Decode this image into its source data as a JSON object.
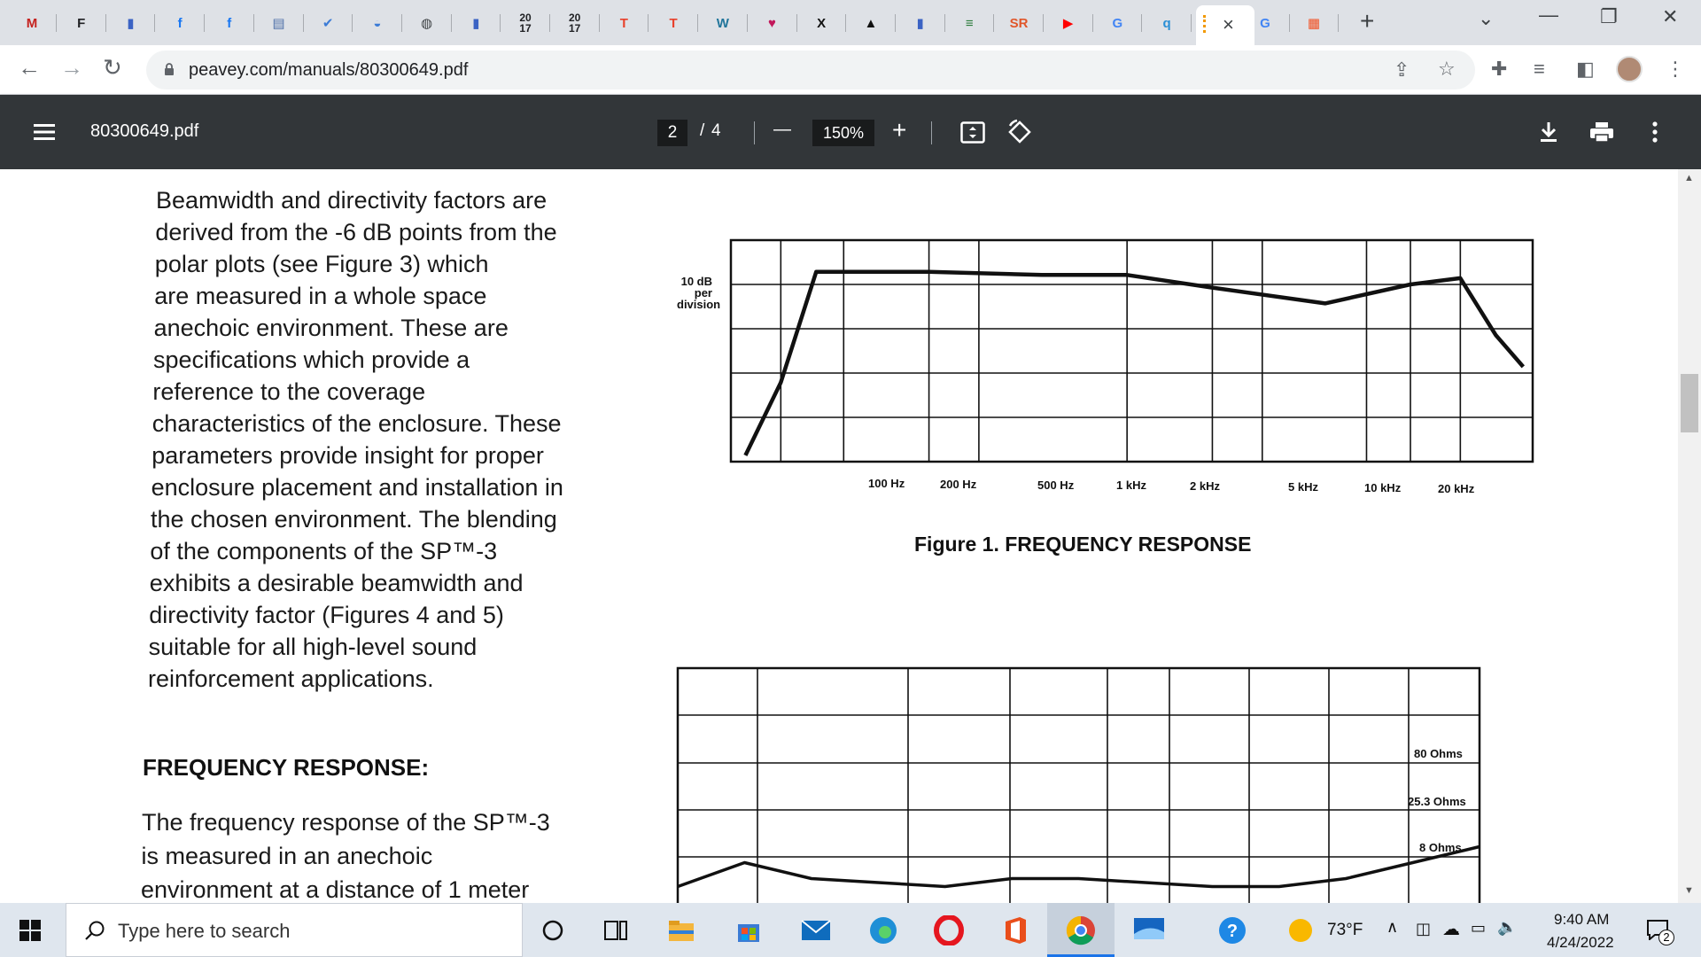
{
  "browser": {
    "tabs": [
      {
        "name": "gmail",
        "glyph": "M",
        "color": "#c5221f"
      },
      {
        "name": "tab-2",
        "glyph": "F",
        "color": "#202124"
      },
      {
        "name": "tab-3",
        "glyph": "▮",
        "color": "#3b63c4"
      },
      {
        "name": "facebook-1",
        "glyph": "f",
        "color": "#1877f2"
      },
      {
        "name": "facebook-2",
        "glyph": "f",
        "color": "#1877f2"
      },
      {
        "name": "tab-6",
        "glyph": "▤",
        "color": "#4d6fa8"
      },
      {
        "name": "tab-7",
        "glyph": "✔",
        "color": "#3b7bd6"
      },
      {
        "name": "tab-8",
        "glyph": "◒",
        "color": "#3b7bd6"
      },
      {
        "name": "tab-9",
        "glyph": "◍",
        "color": "#3c4043"
      },
      {
        "name": "tab-10",
        "glyph": "▮",
        "color": "#3b63c4"
      },
      {
        "name": "tab-2017-a",
        "glyph": "20\n17",
        "color": "#202124"
      },
      {
        "name": "tab-2017-b",
        "glyph": "20\n17",
        "color": "#202124"
      },
      {
        "name": "tab-t-1",
        "glyph": "T",
        "color": "#e8412c"
      },
      {
        "name": "tab-t-2",
        "glyph": "T",
        "color": "#e8412c"
      },
      {
        "name": "wordpress",
        "glyph": "W",
        "color": "#21759b"
      },
      {
        "name": "tab-heart",
        "glyph": "♥",
        "color": "#c2185b"
      },
      {
        "name": "tab-x",
        "glyph": "X",
        "color": "#111111"
      },
      {
        "name": "tab-triangle",
        "glyph": "▲",
        "color": "#111111"
      },
      {
        "name": "tab-12",
        "glyph": "▮",
        "color": "#3b63c4"
      },
      {
        "name": "tab-13",
        "glyph": "≡",
        "color": "#2a7a3a"
      },
      {
        "name": "tab-sr",
        "glyph": "SR",
        "color": "#e0562a"
      },
      {
        "name": "youtube",
        "glyph": "▶",
        "color": "#ff0000"
      },
      {
        "name": "google-1",
        "glyph": "G",
        "color": "#4285f4"
      },
      {
        "name": "tab-q",
        "glyph": "q",
        "color": "#2a8fd6"
      }
    ],
    "after_tabs": [
      {
        "name": "google-2",
        "glyph": "G",
        "color": "#4285f4"
      },
      {
        "name": "microsoft",
        "glyph": "▦",
        "color": "#f25022"
      }
    ],
    "active_tab_close": "×",
    "new_tab": "+",
    "window_controls": {
      "dropdown": "⌄",
      "minimize": "—",
      "restore": "❐",
      "close": "✕"
    },
    "url": "peavey.com/manuals/80300649.pdf"
  },
  "pdf": {
    "title": "80300649.pdf",
    "current_page": "2",
    "page_sep": "/",
    "total_pages": "4",
    "zoom": "150%",
    "zoom_out": "—",
    "zoom_in": "+"
  },
  "document": {
    "paragraph1": [
      "Beamwidth and directivity factors are",
      "derived from the -6 dB points from the",
      "polar plots (see Figure 3) which",
      "are measured in a whole space",
      "anechoic environment. These are",
      "specifications which provide a",
      "reference to the coverage",
      "characteristics of the enclosure. These",
      "parameters provide insight for proper",
      "enclosure placement and installation in",
      "the chosen environment. The blending",
      "of the components of the SP™-3",
      "exhibits a desirable beamwidth and",
      "directivity factor (Figures 4 and 5)",
      "suitable for all high-level sound",
      "reinforcement applications."
    ],
    "heading": "FREQUENCY RESPONSE:",
    "paragraph2": [
      "The frequency response of the SP™-3",
      "is measured in an anechoic",
      "environment at a distance of 1 meter"
    ],
    "figure1": {
      "caption": "Figure 1. FREQUENCY RESPONSE",
      "scale_label": [
        "10 dB",
        "per",
        "division"
      ],
      "x_ticks": [
        "100 Hz",
        "200 Hz",
        "500 Hz",
        "1 kHz",
        "2 kHz",
        "5 kHz",
        "10 kHz",
        "20  kHz"
      ]
    },
    "figure2": {
      "labels": [
        "80 Ohms",
        "25.3 Ohms",
        "8 Ohms"
      ]
    }
  },
  "chart_data": [
    {
      "type": "line",
      "title": "Figure 1. FREQUENCY RESPONSE",
      "ylabel": "10 dB per division",
      "x_scale": "log",
      "x": [
        45,
        60,
        80,
        100,
        200,
        500,
        1000,
        2000,
        5000,
        10000,
        15000,
        20000,
        25000
      ],
      "series": [
        {
          "values": [
            -5.8,
            -3.5,
            0,
            0,
            0,
            -0.1,
            -0.1,
            -0.5,
            -1,
            -0.4,
            -0.2,
            -2,
            -3
          ]
        }
      ],
      "ylim": [
        -6,
        1
      ],
      "grid": true
    },
    {
      "type": "line",
      "title": "",
      "series": [
        {
          "values": [
            0.3,
            0.9,
            0.5,
            0.4,
            0.3,
            0.5,
            0.5,
            0.4,
            0.3,
            0.3,
            0.5,
            0.9,
            1.3
          ]
        }
      ],
      "grid": true
    }
  ],
  "taskbar": {
    "search_placeholder": "Type here to search",
    "weather": "73°F",
    "time": "9:40 AM",
    "date": "4/24/2022",
    "notifications": "2"
  }
}
